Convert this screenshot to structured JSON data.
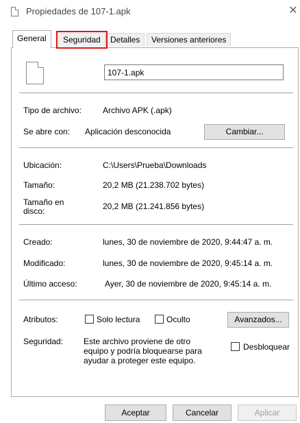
{
  "window": {
    "title": "Propiedades de 107-1.apk",
    "close_glyph": "✕"
  },
  "tabs": [
    {
      "label": "General"
    },
    {
      "label": "Seguridad"
    },
    {
      "label": "Detalles"
    },
    {
      "label": "Versiones anteriores"
    }
  ],
  "file": {
    "name": "107-1.apk"
  },
  "info": {
    "type_label": "Tipo de archivo:",
    "type_value": "Archivo APK (.apk)",
    "opens_label": "Se abre con:",
    "opens_value": "Aplicación desconocida",
    "change_button": "Cambiar...",
    "location_label": "Ubicación:",
    "location_value": "C:\\Users\\Prueba\\Downloads",
    "size_label": "Tamaño:",
    "size_value": "20,2 MB (21.238.702 bytes)",
    "disk_label_line1": "Tamaño en",
    "disk_label_line2": "disco:",
    "disk_value": "20,2 MB (21.241.856 bytes)",
    "created_label": "Creado:",
    "created_value": "lunes, 30 de noviembre de 2020, 9:44:47 a. m.",
    "modified_label": "Modificado:",
    "modified_value": "lunes, 30 de noviembre de 2020, 9:45:14 a. m.",
    "accessed_label": "Último acceso:",
    "accessed_value": "Ayer, 30 de noviembre de 2020, 9:45:14 a. m."
  },
  "attributes": {
    "label": "Atributos:",
    "readonly": "Solo lectura",
    "hidden": "Oculto",
    "advanced_button": "Avanzados..."
  },
  "security": {
    "label": "Seguridad:",
    "line1": "Este archivo proviene de otro",
    "line2": "equipo y podría bloquearse para",
    "line3": "ayudar a proteger este equipo.",
    "unblock": "Desbloquear"
  },
  "buttons": {
    "ok": "Aceptar",
    "cancel": "Cancelar",
    "apply": "Aplicar"
  },
  "colors": {
    "highlight": "#e11111"
  }
}
